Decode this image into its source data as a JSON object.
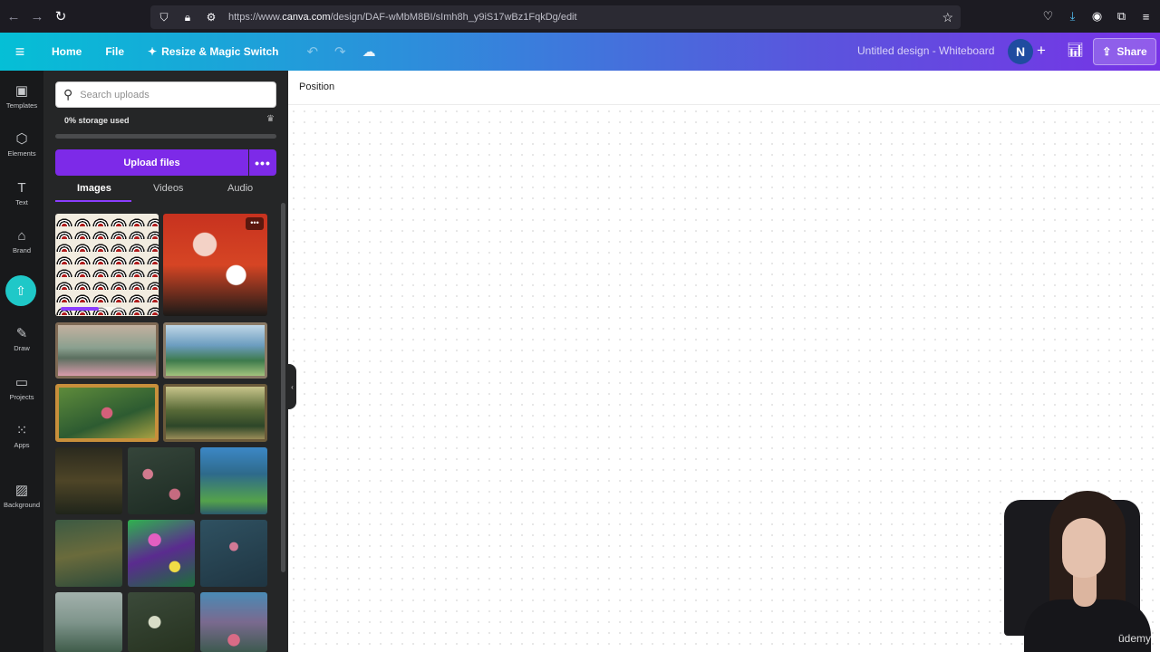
{
  "browser": {
    "url_prefix": "https://www.",
    "url_host": "canva.com",
    "url_path": "/design/DAF-wMbM8BI/sImh8h_y9iS17wBz1FqkDg/edit"
  },
  "topbar": {
    "home": "Home",
    "file": "File",
    "resize": "Resize & Magic Switch",
    "design_title": "Untitled design - Whiteboard",
    "avatar_initial": "N",
    "share": "Share"
  },
  "rail": {
    "items": [
      {
        "label": "Templates",
        "icon": "templates-icon"
      },
      {
        "label": "Elements",
        "icon": "elements-icon"
      },
      {
        "label": "Text",
        "icon": "text-icon"
      },
      {
        "label": "Brand",
        "icon": "brand-icon"
      },
      {
        "label": "Draw",
        "icon": "draw-icon"
      },
      {
        "label": "Projects",
        "icon": "projects-icon"
      },
      {
        "label": "Apps",
        "icon": "apps-icon"
      },
      {
        "label": "Background",
        "icon": "background-icon"
      }
    ]
  },
  "panel": {
    "search_placeholder": "Search uploads",
    "storage": "0% storage used",
    "storage_fraction": 0.0,
    "upload_label": "Upload files",
    "more_label": "•••",
    "tabs": [
      "Images",
      "Videos",
      "Audio"
    ],
    "active_tab": "Images",
    "thumb_menu": "•••"
  },
  "canvas": {
    "position_label": "Position"
  },
  "webcam": {
    "watermark": "ūdemy"
  },
  "colors": {
    "accent": "#8b3dff",
    "upload_button": "#7d2ae8",
    "rail_upload": "#1fc8c8"
  }
}
